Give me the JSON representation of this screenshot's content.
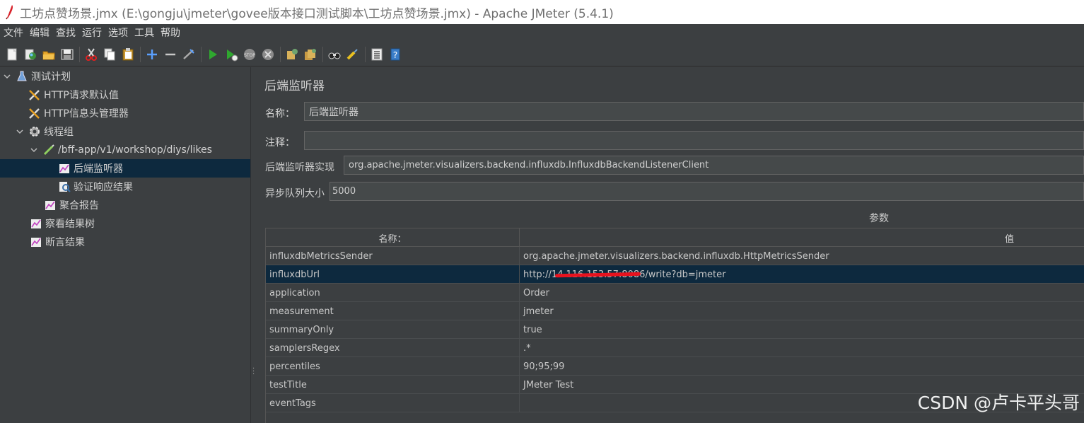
{
  "window": {
    "title": "工坊点赞场景.jmx (E:\\gongju\\jmeter\\govee版本接口测试脚本\\工坊点赞场景.jmx) - Apache JMeter (5.4.1)"
  },
  "menu": {
    "items": [
      "文件",
      "编辑",
      "查找",
      "运行",
      "选项",
      "工具",
      "帮助"
    ]
  },
  "toolbar": {
    "icons": [
      "new-icon",
      "templates-icon",
      "open-icon",
      "save-icon",
      "cut-icon",
      "copy-icon",
      "paste-icon",
      "expand-icon",
      "collapse-icon",
      "toggle-icon",
      "start-icon",
      "start-no-timers-icon",
      "stop-icon",
      "shutdown-icon",
      "clear-icon",
      "clear-all-icon",
      "search-icon",
      "reset-search-icon",
      "function-helper-icon",
      "help-icon"
    ]
  },
  "tree": {
    "items": [
      {
        "label": "测试计划",
        "icon": "test-plan-icon"
      },
      {
        "label": "HTTP请求默认值",
        "icon": "config-element-icon"
      },
      {
        "label": "HTTP信息头管理器",
        "icon": "config-element-icon"
      },
      {
        "label": "线程组",
        "icon": "thread-group-icon"
      },
      {
        "label": "/bff-app/v1/workshop/diys/likes",
        "icon": "sampler-icon"
      },
      {
        "label": "后端监听器",
        "icon": "listener-icon"
      },
      {
        "label": "验证响应结果",
        "icon": "assertion-icon"
      },
      {
        "label": "聚合报告",
        "icon": "listener-icon"
      },
      {
        "label": "察看结果树",
        "icon": "listener-icon"
      },
      {
        "label": "断言结果",
        "icon": "listener-icon"
      }
    ]
  },
  "panel": {
    "title": "后端监听器",
    "name_label": "名称：",
    "name_value": "后端监听器",
    "comment_label": "注释：",
    "comment_value": "",
    "impl_label": "后端监听器实现",
    "impl_value": "org.apache.jmeter.visualizers.backend.influxdb.InfluxdbBackendListenerClient",
    "queue_label": "异步队列大小",
    "queue_value": "5000",
    "params_title": "参数",
    "table": {
      "headers": [
        "名称：",
        "值"
      ],
      "rows": [
        {
          "name": "influxdbMetricsSender",
          "value": "org.apache.jmeter.visualizers.backend.influxdb.HttpMetricsSender"
        },
        {
          "name": "influxdbUrl",
          "value": "http://14.116.153.57:8086/write?db=jmeter"
        },
        {
          "name": "application",
          "value": "Order"
        },
        {
          "name": "measurement",
          "value": "jmeter"
        },
        {
          "name": "summaryOnly",
          "value": "true"
        },
        {
          "name": "samplersRegex",
          "value": ".*"
        },
        {
          "name": "percentiles",
          "value": "90;95;99"
        },
        {
          "name": "testTitle",
          "value": "JMeter Test"
        },
        {
          "name": "eventTags",
          "value": ""
        }
      ]
    }
  },
  "watermark": "CSDN @卢卡平头哥"
}
